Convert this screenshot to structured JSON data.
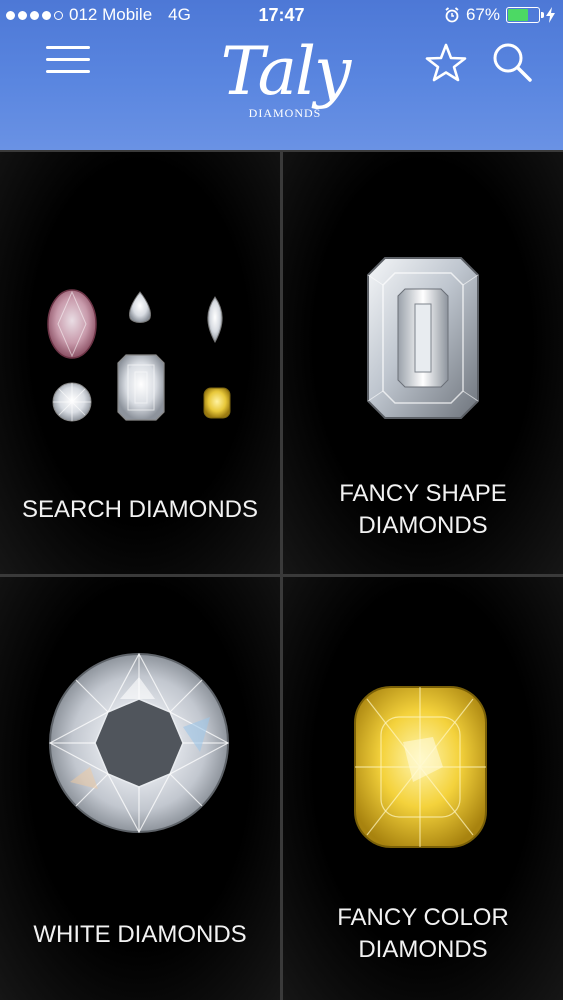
{
  "status_bar": {
    "carrier": "012 Mobile",
    "network": "4G",
    "time": "17:47",
    "battery": "67%",
    "battery_level": 0.67,
    "signal_bars": 4
  },
  "header": {
    "logo_script": "Taly",
    "logo_sub": "DIAMONDS",
    "menu_icon": "hamburger-menu-icon",
    "favorites_icon": "star-icon",
    "search_icon": "search-icon"
  },
  "tiles": [
    {
      "label_lines": [
        "SEARCH DIAMONDS"
      ],
      "image": "assorted-diamonds"
    },
    {
      "label_lines": [
        "FANCY SHAPE",
        "DIAMONDS"
      ],
      "image": "emerald-cut-diamond"
    },
    {
      "label_lines": [
        "WHITE DIAMONDS"
      ],
      "image": "round-white-diamond"
    },
    {
      "label_lines": [
        "FANCY COLOR",
        "DIAMONDS"
      ],
      "image": "yellow-cushion-diamond"
    }
  ],
  "colors": {
    "header_blue": "#5a86e0",
    "battery_green": "#4cd964",
    "tile_background": "#000000",
    "yellow_diamond": "#f4d23c"
  }
}
